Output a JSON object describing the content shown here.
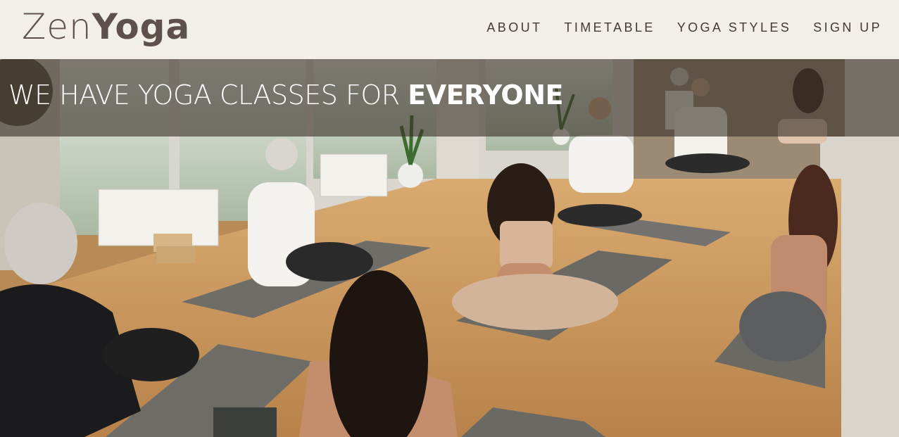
{
  "brand": {
    "name_light": "Zen",
    "name_bold": "Yoga"
  },
  "nav": {
    "items": [
      {
        "label": "ABOUT"
      },
      {
        "label": "TIMETABLE"
      },
      {
        "label": "YOGA STYLES"
      },
      {
        "label": "SIGN UP"
      }
    ]
  },
  "hero": {
    "headline_light": "WE HAVE YOGA CLASSES FOR ",
    "headline_bold": "EVERYONE",
    "image_subject": "yoga-class-photo"
  },
  "colors": {
    "header_bg": "#f1efe8",
    "logo": "#5e514b",
    "nav_text": "#3f3a37",
    "banner_overlay": "rgba(58,50,40,0.62)",
    "floor": "#c8955d"
  }
}
